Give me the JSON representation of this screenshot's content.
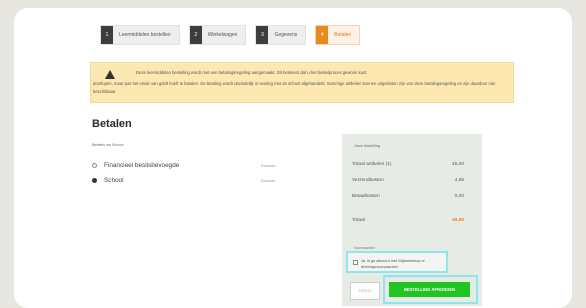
{
  "steps": [
    {
      "num": "1",
      "label": "Leermiddelen bestellen"
    },
    {
      "num": "2",
      "label": "Winkelwagen"
    },
    {
      "num": "3",
      "label": "Gegevens"
    },
    {
      "num": "4",
      "label": "Betalen"
    }
  ],
  "alert": {
    "line1": "Deze leermiddelen bestelling wordt met een betalingsregeling aangemaakt. Dit betekent dat u het bestelproces gewoon kunt",
    "line2": "doorlopen, maar pas het einde van geldt hoeft te betalen. De betaling wordt uiteindelijk in overleg met de school afgehandeld. Sommige artikelen kunnen uitgesloten zijn van deze betalingsregeling en zijn daardoor niet beschikbaar."
  },
  "page": {
    "title": "Betalen",
    "subtitle": "Betalen via School"
  },
  "options": [
    {
      "label": "Financieel beslisbevoegde",
      "extra": "Ecotrade"
    },
    {
      "label": "School",
      "extra": "Ecotrade"
    }
  ],
  "summary": {
    "heading": "Jouw bestelling",
    "rows": [
      {
        "label": "Totaal artikelen (1)",
        "value": "45,00"
      },
      {
        "label": "Verzendkosten",
        "value": "4,95"
      },
      {
        "label": "Betaalkosten",
        "value": "0,00"
      },
      {
        "label": "Totaal",
        "value": "49,95"
      }
    ],
    "voorwaarden_label": "Voorwaarden",
    "agree_text": "Ja, ik ga akkoord met Wijzwebshop.nl leveringsvoorwaarden",
    "back_button": "TERUG",
    "order_button": "BESTELLING AFRONDEN"
  }
}
